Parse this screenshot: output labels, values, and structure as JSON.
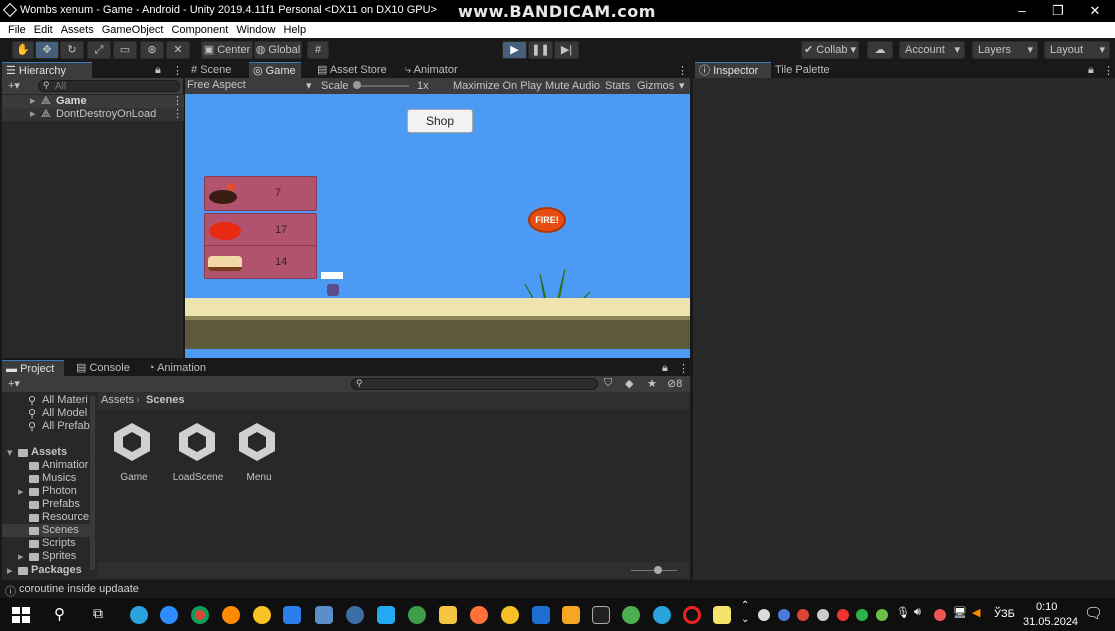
{
  "window": {
    "title": "Wombs xenum - Game - Android - Unity 2019.4.11f1 Personal <DX11 on DX10 GPU>",
    "watermark": "www.BANDICAM.com"
  },
  "menu": [
    "File",
    "Edit",
    "Assets",
    "GameObject",
    "Component",
    "Window",
    "Help"
  ],
  "toolbar": {
    "center": "Center",
    "global": "Global",
    "collab": "Collab",
    "account": "Account",
    "layers": "Layers",
    "layout": "Layout"
  },
  "hierarchy": {
    "tab": "Hierarchy",
    "search_placeholder": "All",
    "items": [
      "Game",
      "DontDestroyOnLoad"
    ]
  },
  "center_tabs": [
    "Scene",
    "Game",
    "Asset Store",
    "Animator"
  ],
  "game_bar": {
    "aspect": "Free Aspect",
    "scale_label": "Scale",
    "scale_value": "1x",
    "maximize": "Maximize On Play",
    "mute": "Mute Audio",
    "stats": "Stats",
    "gizmos": "Gizmos"
  },
  "game": {
    "shop": "Shop",
    "fire": "FIRE!",
    "inventory": [
      "7",
      "17",
      "14"
    ]
  },
  "inspector_tabs": [
    "Inspector",
    "Tile Palette"
  ],
  "project": {
    "tabs": [
      "Project",
      "Console",
      "Animation"
    ],
    "favorites": [
      "All Materi",
      "All Model",
      "All Prefab"
    ],
    "assets_label": "Assets",
    "folders": [
      "Animatior",
      "Musics",
      "Photon",
      "Prefabs",
      "Resource",
      "Scenes",
      "Scripts",
      "Sprites"
    ],
    "packages": "Packages",
    "breadcrumb": [
      "Assets",
      "Scenes"
    ],
    "scenes": [
      "Game",
      "LoadScene",
      "Menu"
    ],
    "hidden_count": "8"
  },
  "status": "coroutine inside updaate",
  "taskbar": {
    "lang": "ЎЗБ",
    "time": "0:10",
    "date": "31.05.2024"
  }
}
